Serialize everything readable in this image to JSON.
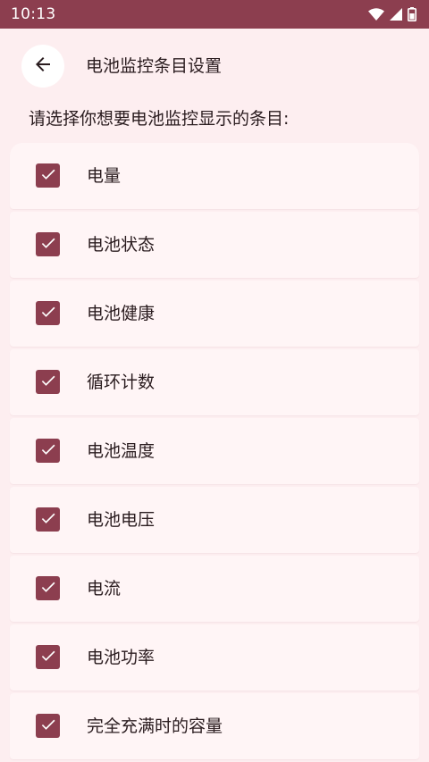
{
  "status_bar": {
    "time": "10:13",
    "icons": [
      "wifi-icon",
      "signal-icon",
      "battery-icon"
    ]
  },
  "header": {
    "title": "电池监控条目设置",
    "back_icon": "arrow-left-icon"
  },
  "subtitle": "请选择你想要电池监控显示的条目:",
  "items": [
    {
      "label": "电量",
      "checked": true
    },
    {
      "label": "电池状态",
      "checked": true
    },
    {
      "label": "电池健康",
      "checked": true
    },
    {
      "label": "循环计数",
      "checked": true
    },
    {
      "label": "电池温度",
      "checked": true
    },
    {
      "label": "电池电压",
      "checked": true
    },
    {
      "label": "电流",
      "checked": true
    },
    {
      "label": "电池功率",
      "checked": true
    },
    {
      "label": "完全充满时的容量",
      "checked": true
    }
  ],
  "colors": {
    "accent": "#8c3e4f",
    "background": "#fdeef0",
    "card": "#fff5f6"
  }
}
